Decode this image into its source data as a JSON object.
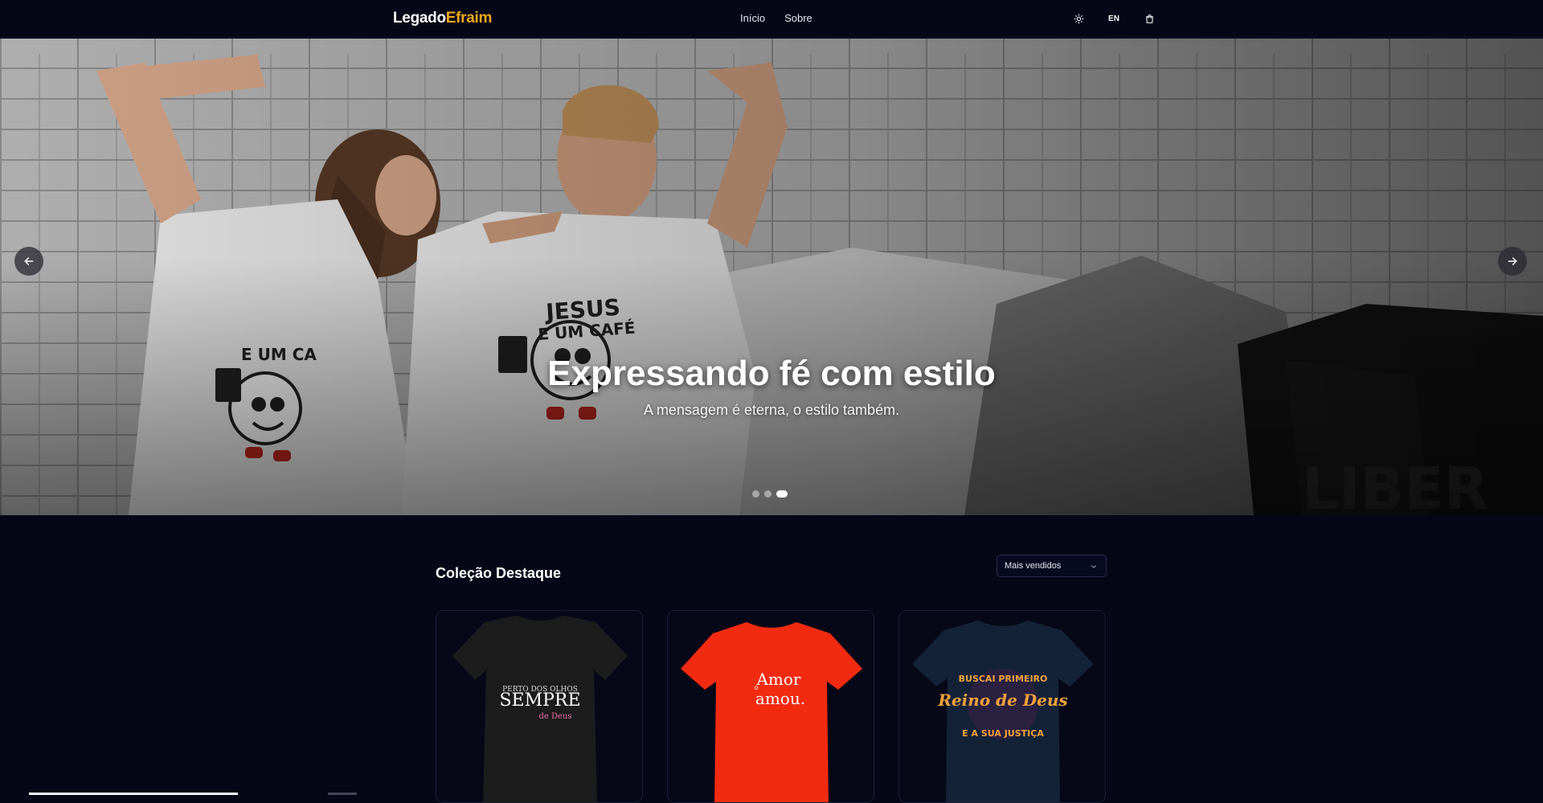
{
  "header": {
    "logo_part_a": "Legado",
    "logo_part_b": "Efraim",
    "nav": [
      {
        "label": "Início"
      },
      {
        "label": "Sobre"
      }
    ],
    "theme_icon": "sun-icon",
    "language_label": "EN",
    "cart_icon": "shopping-bag-icon"
  },
  "hero": {
    "title": "Expressando fé com estilo",
    "subtitle": "A mensagem é eterna, o estilo também.",
    "prev_icon": "arrow-left-icon",
    "next_icon": "arrow-right-icon",
    "slides_total": 3,
    "active_slide": 3,
    "shirt_print_text": "JESUS E UM CAFÉ"
  },
  "featured": {
    "title": "Coleção Destaque",
    "sort_selected": "Mais vendidos",
    "products": [
      {
        "shirt_color": "#1c1c1c",
        "print": "SEMPRE"
      },
      {
        "shirt_color": "#f22a10",
        "print": "Amor amou"
      },
      {
        "shirt_color": "#142238",
        "print": "Reino de Deus"
      }
    ]
  },
  "colors": {
    "background": "#050616",
    "accent": "#f0a81c"
  }
}
